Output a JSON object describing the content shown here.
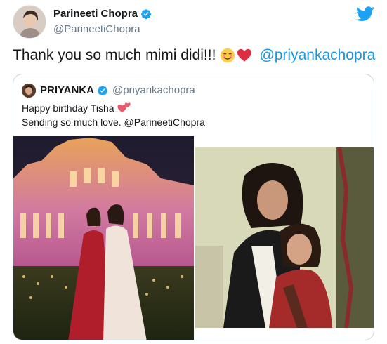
{
  "tweet": {
    "display_name": "Parineeti Chopra",
    "handle": "@ParineetiChopra",
    "text": "Thank you so much mimi didi!!!",
    "mention": "@priyankachopra",
    "emojis": [
      "smiling-face-emoji",
      "red-heart-emoji"
    ]
  },
  "quoted_tweet": {
    "display_name": "PRIYANKA",
    "handle": "@priyankachopra",
    "line1": "Happy birthday Tisha",
    "line2_text": "Sending so much love.",
    "line2_mention": "@ParineetiChopra",
    "photos": [
      "night-palace-photo",
      "vintage-family-photo"
    ]
  },
  "colors": {
    "accent": "#1b95e0",
    "secondary_text": "#657786",
    "border": "#ccd6dd"
  }
}
